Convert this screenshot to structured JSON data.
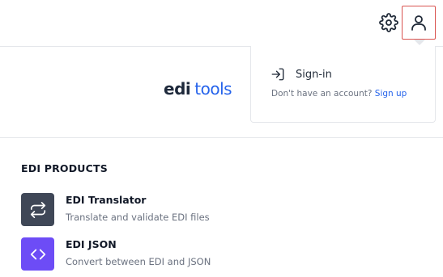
{
  "header": {
    "settings_icon": "gear-icon",
    "account_icon": "user-icon",
    "accent_border": "#d9534f"
  },
  "logo": {
    "part1": "edi",
    "part2": "tools",
    "color_dark": "#1e293b",
    "color_blue": "#2563eb"
  },
  "account_menu": {
    "signin_icon": "sign-in-icon",
    "signin_label": "Sign-in",
    "no_account_text": "Don't have an account?",
    "signup_label": "Sign up"
  },
  "products": {
    "title": "EDI PRODUCTS",
    "items": [
      {
        "name": "EDI Translator",
        "description": "Translate and validate EDI files",
        "icon": "swap-arrows-icon",
        "color": "#3f4757"
      },
      {
        "name": "EDI JSON",
        "description": "Convert between EDI and JSON",
        "icon": "code-brackets-icon",
        "color": "#6d4cf6"
      }
    ]
  }
}
